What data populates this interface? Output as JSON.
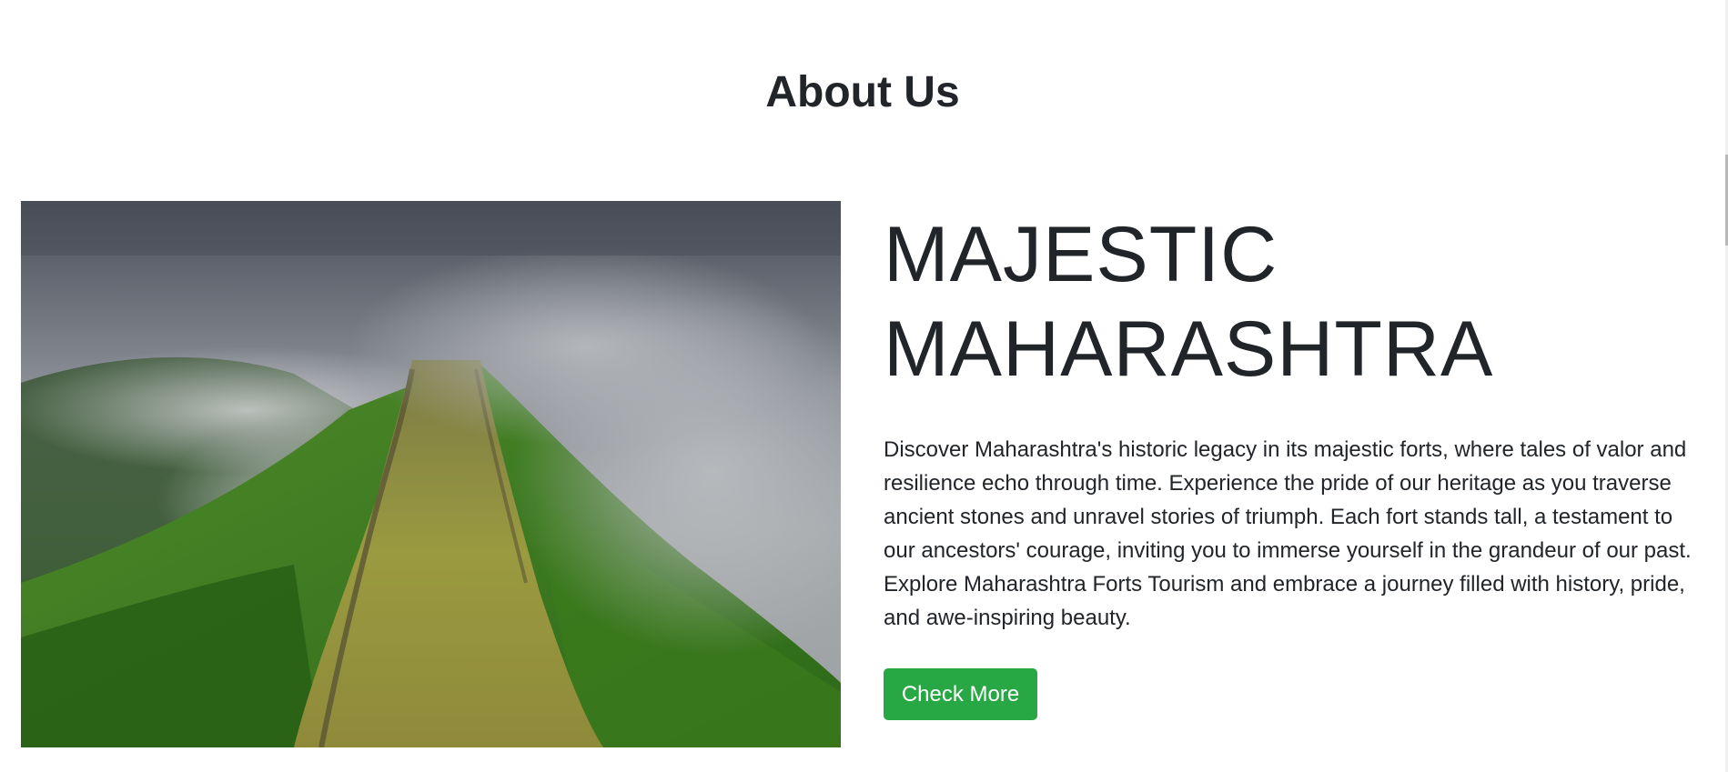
{
  "about": {
    "section_title": "About Us",
    "heading_line1": "MAJESTIC",
    "heading_line2": "MAHARASHTRA",
    "description": "Discover Maharashtra's historic legacy in its majestic forts, where tales of valor and resilience echo through time. Experience the pride of our heritage as you traverse ancient stones and unravel stories of triumph. Each fort stands tall, a testament to our ancestors' courage, inviting you to immerse yourself in the grandeur of our past. Explore Maharashtra Forts Tourism and embrace a journey filled with history, pride, and awe-inspiring beauty.",
    "button_label": "Check More",
    "image_subject": "misty-green-mountain-fort-ridge"
  },
  "colors": {
    "button_bg": "#28a745",
    "button_text": "#ffffff",
    "text": "#212529",
    "background": "#ffffff"
  }
}
